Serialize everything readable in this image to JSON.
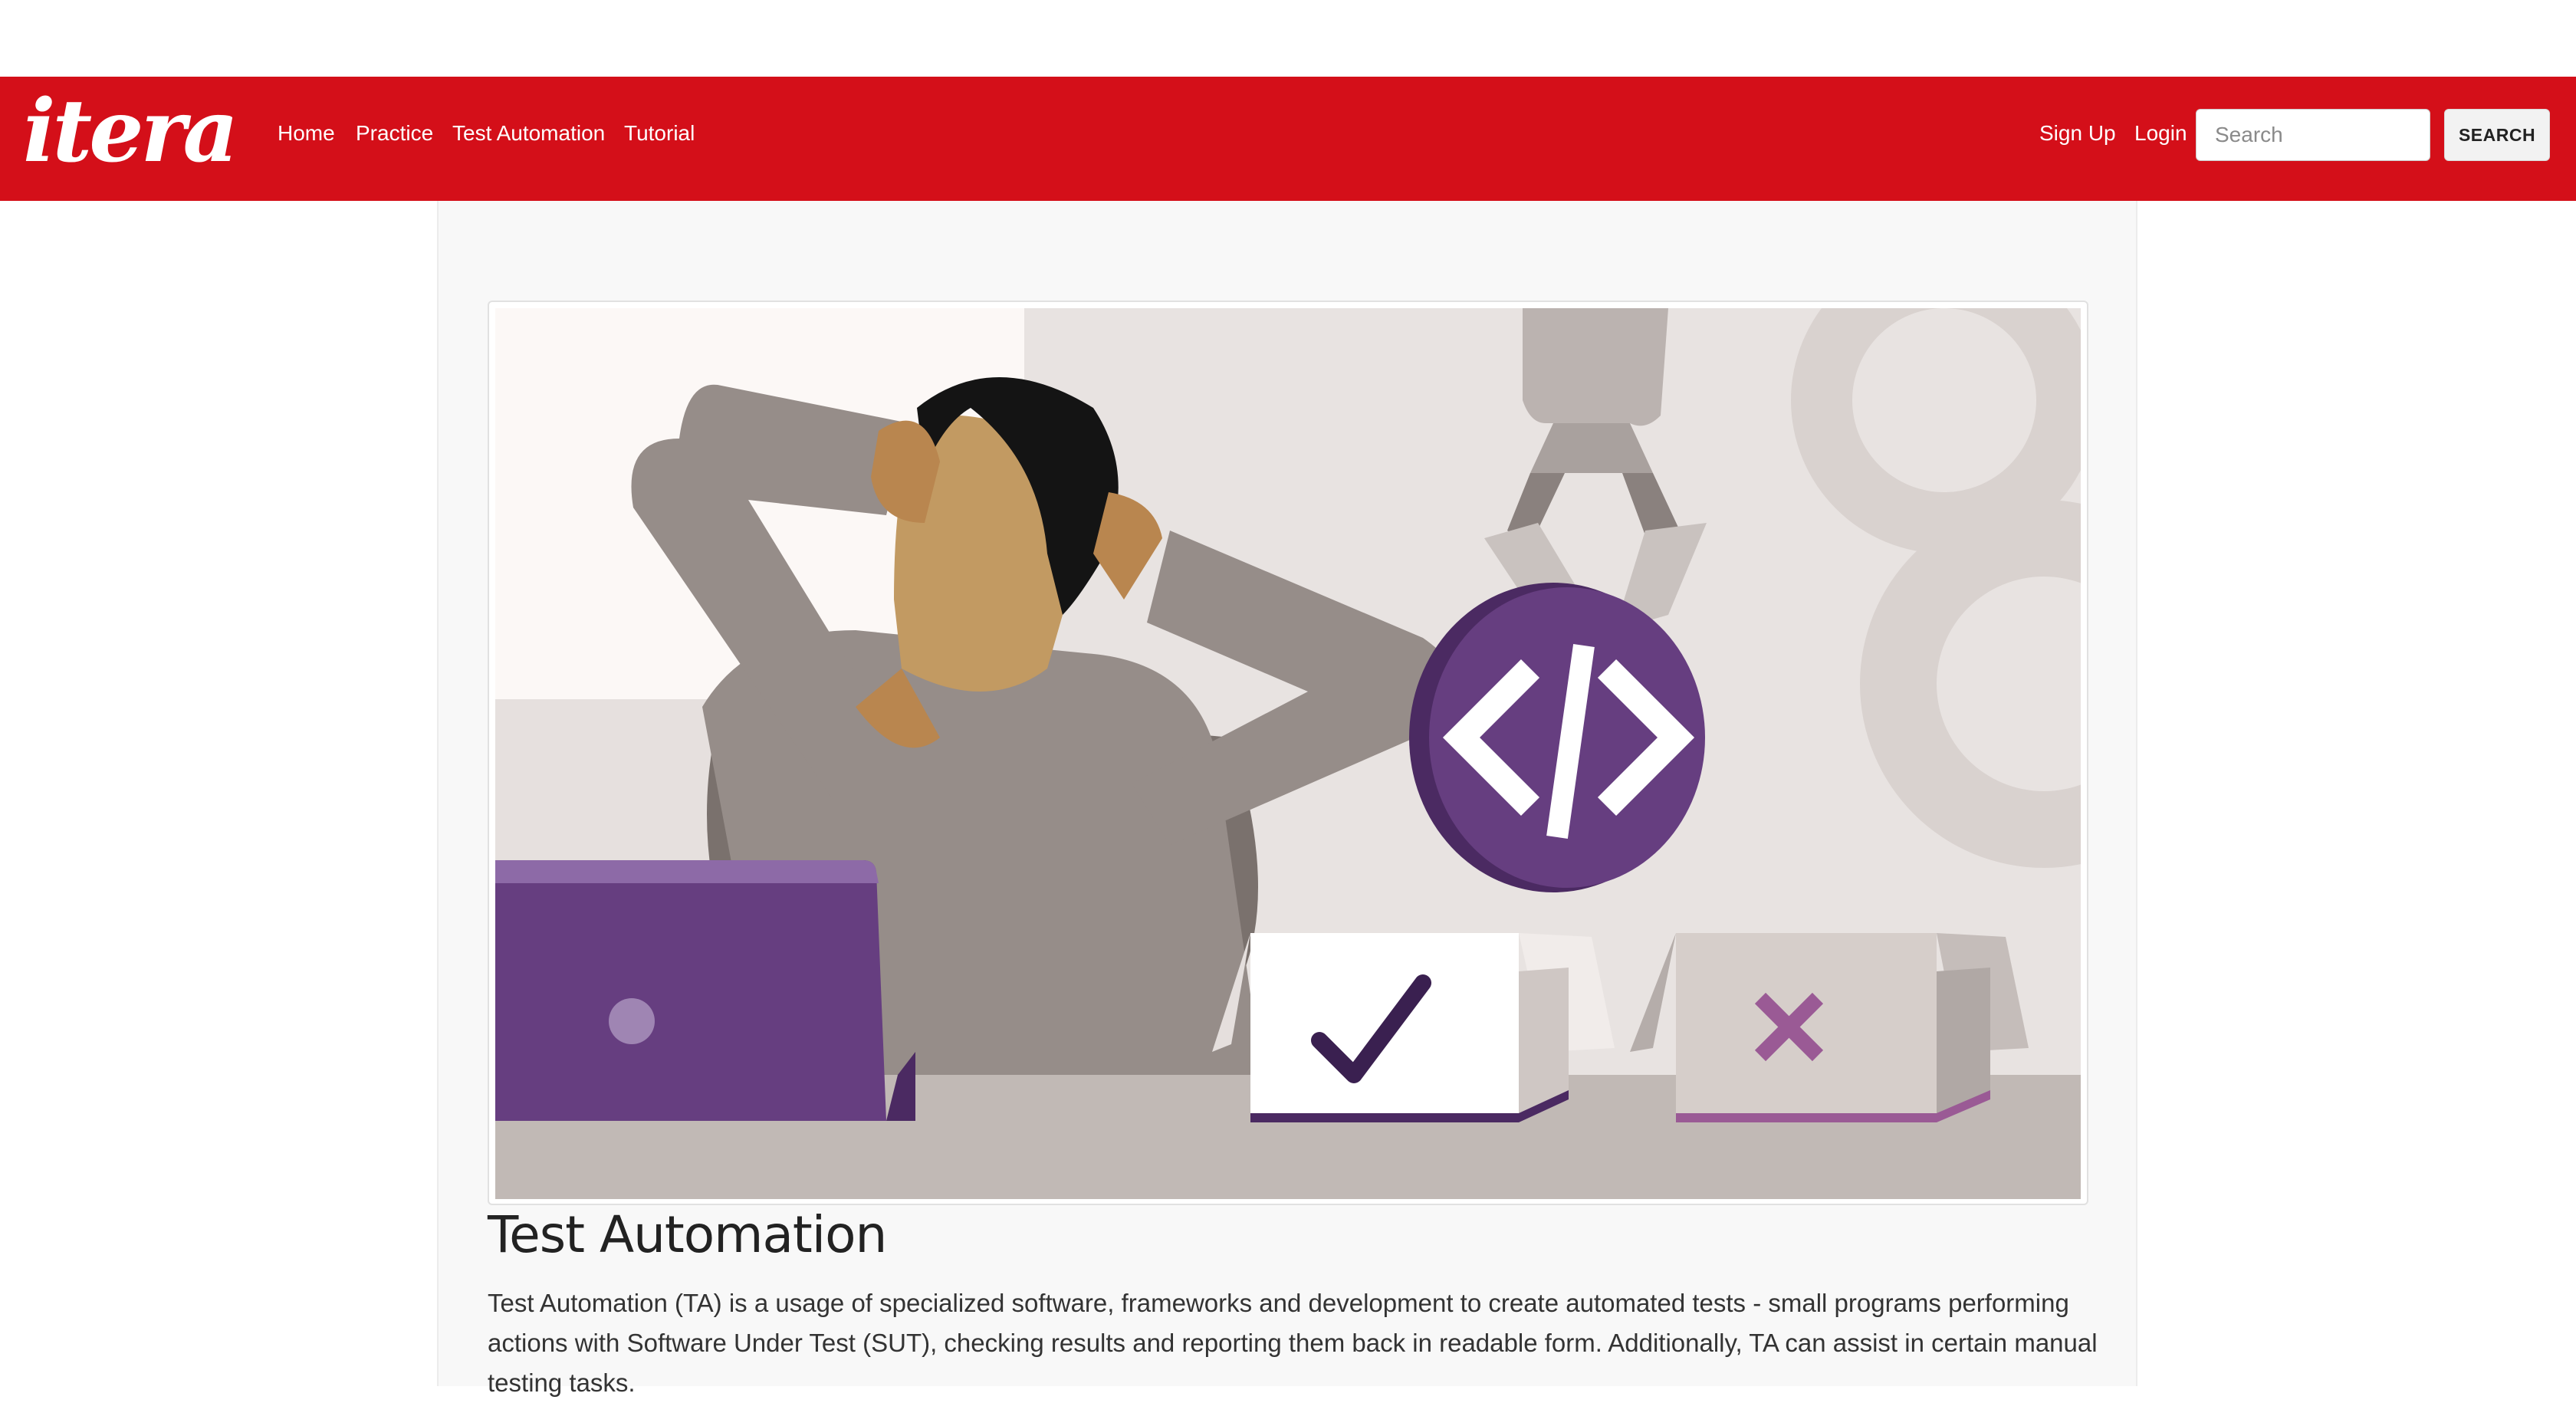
{
  "brand": {
    "logo_text": "itera",
    "color": "#d40f19"
  },
  "nav": {
    "links": [
      {
        "label": "Home"
      },
      {
        "label": "Practice"
      },
      {
        "label": "Test Automation"
      },
      {
        "label": "Tutorial"
      }
    ],
    "sign_up": "Sign Up",
    "login": "Login",
    "search_placeholder": "Search",
    "search_button": "SEARCH"
  },
  "hero": {
    "illustration": "man-relaxing-robot-arm-code-icon",
    "code_icon": "</>",
    "check_icon": "checkmark-icon",
    "cross_icon": "x-icon"
  },
  "main": {
    "title": "Test Automation",
    "description": "Test Automation (TA) is a usage of specialized software, frameworks and development to create automated tests - small programs performing actions with Software Under Test (SUT), checking results and reporting them back in readable form. Additionally, TA can assist in certain manual testing tasks."
  }
}
